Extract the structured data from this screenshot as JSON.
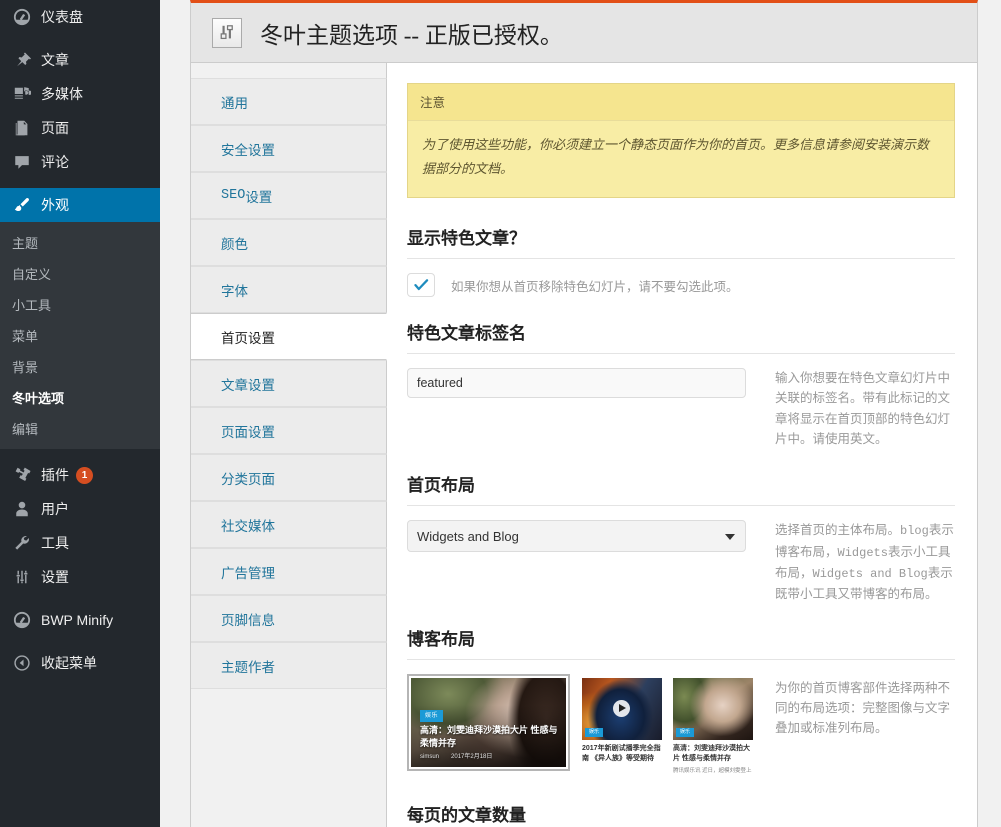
{
  "admin_menu": {
    "items": [
      {
        "label": "仪表盘",
        "icon": "dashboard-icon",
        "current": false
      },
      {
        "label": "文章",
        "icon": "pin-icon",
        "current": false,
        "gap_before": true
      },
      {
        "label": "多媒体",
        "icon": "media-icon",
        "current": false
      },
      {
        "label": "页面",
        "icon": "page-icon",
        "current": false
      },
      {
        "label": "评论",
        "icon": "comment-icon",
        "current": false
      },
      {
        "label": "外观",
        "icon": "brush-icon",
        "current": true,
        "gap_before": true
      },
      {
        "label": "插件",
        "icon": "plugin-icon",
        "current": false,
        "badge": "1",
        "gap_before": true
      },
      {
        "label": "用户",
        "icon": "user-icon",
        "current": false
      },
      {
        "label": "工具",
        "icon": "wrench-icon",
        "current": false
      },
      {
        "label": "设置",
        "icon": "settings-icon",
        "current": false
      },
      {
        "label": "BWP Minify",
        "icon": "gauge-icon",
        "current": false,
        "gap_before": true
      },
      {
        "label": "收起菜单",
        "icon": "collapse-icon",
        "current": false,
        "gap_before": true
      }
    ],
    "appearance_submenu": [
      {
        "label": "主题",
        "current": false
      },
      {
        "label": "自定义",
        "current": false
      },
      {
        "label": "小工具",
        "current": false
      },
      {
        "label": "菜单",
        "current": false
      },
      {
        "label": "背景",
        "current": false
      },
      {
        "label": "冬叶选项",
        "current": true
      },
      {
        "label": "编辑",
        "current": false
      }
    ]
  },
  "panel": {
    "title": "冬叶主题选项 -- 正版已授权。",
    "title_icon": "sliders-icon",
    "accent_color": "#e24f17"
  },
  "tabs": [
    {
      "label": "通用",
      "active": false
    },
    {
      "label": "安全设置",
      "active": false
    },
    {
      "label": "SEO设置",
      "active": false,
      "mono_prefix": "SEO",
      "rest": "设置"
    },
    {
      "label": "颜色",
      "active": false
    },
    {
      "label": "字体",
      "active": false
    },
    {
      "label": "首页设置",
      "active": true
    },
    {
      "label": "文章设置",
      "active": false
    },
    {
      "label": "页面设置",
      "active": false
    },
    {
      "label": "分类页面",
      "active": false
    },
    {
      "label": "社交媒体",
      "active": false
    },
    {
      "label": "广告管理",
      "active": false
    },
    {
      "label": "页脚信息",
      "active": false
    },
    {
      "label": "主题作者",
      "active": false
    }
  ],
  "notice": {
    "heading": "注意",
    "body": "为了使用这些功能，你必须建立一个静态页面作为你的首页。更多信息请参阅安装演示数据部分的文档。",
    "bg_color": "#f7e998",
    "border_color": "#e4d588"
  },
  "sections": {
    "featured_posts": {
      "title": "显示特色文章？",
      "checkbox_checked": true,
      "checkbox_label": "如果你想从首页移除特色幻灯片，请不要勾选此项。",
      "check_color": "#1e8cbe"
    },
    "featured_tag": {
      "title": "特色文章标签名",
      "input_value": "featured",
      "input_placeholder": "featured",
      "description": "输入你想要在特色文章幻灯片中关联的标签名。带有此标记的文章将显示在首页顶部的特色幻灯片中。请使用英文。"
    },
    "home_layout": {
      "title": "首页布局",
      "selected": "Widgets and Blog",
      "options": [
        "blog",
        "Widgets",
        "Widgets and Blog"
      ],
      "description_parts": [
        {
          "text": "选择首页的主体布局。",
          "mono": false
        },
        {
          "text": "blog",
          "mono": true
        },
        {
          "text": "表示博客布局，",
          "mono": false
        },
        {
          "text": "Widgets",
          "mono": true
        },
        {
          "text": "表示小工具布局，",
          "mono": false
        },
        {
          "text": "Widgets and Blog",
          "mono": true
        },
        {
          "text": "表示既带小工具又带博客的布局。",
          "mono": false
        }
      ]
    },
    "blog_layout": {
      "title": "博客布局",
      "description": "为你的首页博客部件选择两种不同的布局选项：完整图像与文字叠加或标准列布局。",
      "selected_index": 0,
      "option_full": {
        "category": "娱乐",
        "title": "高清：刘雯迪拜沙漠拍大片 性感与柔情并存",
        "author": "simsun",
        "date": "2017年2月18日"
      },
      "option_columns": [
        {
          "category": "娱乐",
          "title": "2017年新剧试播季完全指南 《异人族》等受期待",
          "has_play_icon": true
        },
        {
          "category": "娱乐",
          "title": "高清：刘雯迪拜沙漠拍大片 性感与柔情并存",
          "excerpt": "腾讯娱乐讯 近日，超模刘雯登上",
          "has_play_icon": false
        }
      ]
    },
    "posts_per_page": {
      "title": "每页的文章数量"
    }
  }
}
